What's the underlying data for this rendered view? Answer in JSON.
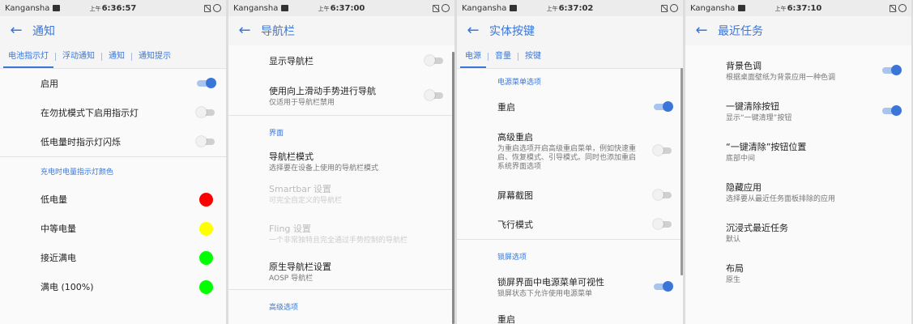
{
  "screens": [
    {
      "status": {
        "carrier": "Kangansha",
        "ampm": "上午",
        "time": "6:36:57"
      },
      "title": "通知",
      "tabs": [
        "电池指示灯",
        "浮动通知",
        "通知",
        "通知提示"
      ],
      "items": {
        "enable": "启用",
        "dnd_light": "在勿扰模式下启用指示灯",
        "low_blink": "低电量时指示灯闪烁",
        "section": "充电时电量指示灯颜色",
        "low": "低电量",
        "mid": "中等电量",
        "near_full": "接近满电",
        "full": "满电 (100%)"
      },
      "colors": {
        "low": "#ff0000",
        "mid": "#ffff00",
        "near_full": "#00ff00",
        "full": "#00ff00"
      }
    },
    {
      "status": {
        "carrier": "Kangansha",
        "ampm": "上午",
        "time": "6:37:00"
      },
      "title": "导航栏",
      "items": {
        "show_nav": "显示导航栏",
        "swipe_label": "使用向上滑动手势进行导航",
        "swipe_sub": "仅适用于导航栏禁用",
        "section_ui": "界面",
        "mode_label": "导航栏模式",
        "mode_sub": "选择要在设备上使用的导航栏模式",
        "smartbar_label": "Smartbar 设置",
        "smartbar_sub": "可完全自定义的导航栏",
        "fling_label": "Fling 设置",
        "fling_sub": "一个非常独特且完全通过手势控制的导航栏",
        "native_label": "原生导航栏设置",
        "native_sub": "AOSP 导航栏",
        "section_adv": "高级选项"
      }
    },
    {
      "status": {
        "carrier": "Kangansha",
        "ampm": "上午",
        "time": "6:37:02"
      },
      "title": "实体按键",
      "tabs": [
        "电源",
        "音量",
        "按键"
      ],
      "items": {
        "section_power": "电源菜单选项",
        "reboot": "重启",
        "adv_reboot_label": "高级重启",
        "adv_reboot_sub": "为重启选项开启高级重启菜单，例如快速重启、恢复模式、引导模式。同时也添加重启系统界面选项",
        "screenshot": "屏幕截图",
        "airplane": "飞行模式",
        "section_lock": "锁屏选项",
        "lock_vis_label": "锁屏界面中电源菜单可视性",
        "lock_vis_sub": "锁屏状态下允许使用电源菜单",
        "partial": "重启"
      }
    },
    {
      "status": {
        "carrier": "Kangansha",
        "ampm": "上午",
        "time": "6:37:10"
      },
      "title": "最近任务",
      "items": {
        "bg_label": "背景色调",
        "bg_sub": "根据桌面壁纸为背景应用一种色调",
        "clear_label": "一键清除按钮",
        "clear_sub": "显示“一键清理”按钮",
        "pos_label": "“一键清除”按钮位置",
        "pos_sub": "底部中间",
        "hide_label": "隐藏应用",
        "hide_sub": "选择要从最近任务面板排除的应用",
        "immersive_label": "沉浸式最近任务",
        "immersive_sub": "默认",
        "layout_label": "布局",
        "layout_sub": "原生"
      }
    }
  ],
  "icons": {
    "back": "arrow-left-icon",
    "image": "image-icon",
    "sim": "no-sim-icon",
    "circle": "circle-icon"
  },
  "accent": "#3a76d8"
}
